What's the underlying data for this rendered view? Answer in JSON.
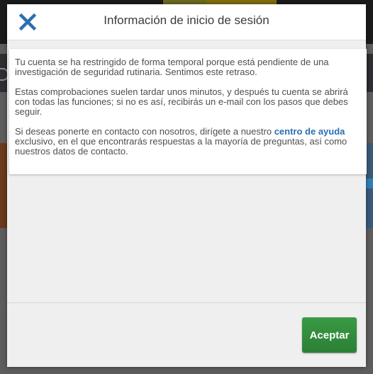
{
  "modal": {
    "title": "Información de inicio de sesión",
    "close_icon": "close-x-icon",
    "paragraph_1": "Tu cuenta se ha restringido de forma temporal porque está pendiente de una investigación de seguridad rutinaria. Sentimos este retraso.",
    "paragraph_2": "Estas comprobaciones suelen tardar unos minutos, y después tu cuenta se abrirá con todas las funciones; si no es así, recibirás un e-mail con los pasos que debes seguir.",
    "paragraph_3_before": "Si deseas ponerte en contacto con nosotros, dirígete a nuestro",
    "paragraph_3_link": "centro de ayuda",
    "paragraph_3_after": "exclusivo, en el que encontrarás respuestas a la mayoría de preguntas, así como nuestros datos de contacto.",
    "accept_label": "Aceptar"
  },
  "colors": {
    "close_icon": "#2a6fb0",
    "link": "#2a6fb0",
    "accept_button": "#2f8a3a",
    "modal_background": "#efefef"
  }
}
